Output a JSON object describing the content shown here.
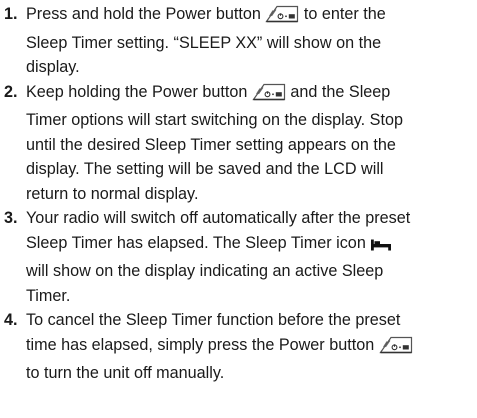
{
  "steps": [
    {
      "number": "1.",
      "lines": [
        [
          "Press and hold the Power button ",
          "power-icon",
          " to enter the"
        ],
        [
          "Sleep Timer setting. “SLEEP XX” will show on the"
        ],
        [
          "display."
        ]
      ]
    },
    {
      "number": "2.",
      "lines": [
        [
          "Keep holding the Power button ",
          "power-icon",
          " and the Sleep"
        ],
        [
          "Timer options will start switching on the display. Stop"
        ],
        [
          "until the desired Sleep Timer setting appears on the"
        ],
        [
          "display. The setting will be saved and the LCD will"
        ],
        [
          "return to normal display."
        ]
      ]
    },
    {
      "number": "3.",
      "lines": [
        [
          "Your radio will switch off automatically after the preset"
        ],
        [
          "Sleep Timer has elapsed. The Sleep Timer icon ",
          "sleep-timer-icon"
        ],
        [
          "will show on the display indicating an active Sleep"
        ],
        [
          "Timer."
        ]
      ]
    },
    {
      "number": "4.",
      "lines": [
        [
          "To cancel the Sleep Timer function before the preset"
        ],
        [
          "time has elapsed, simply press the Power button ",
          "power-icon"
        ],
        [
          "to turn the unit off manually."
        ]
      ]
    }
  ]
}
